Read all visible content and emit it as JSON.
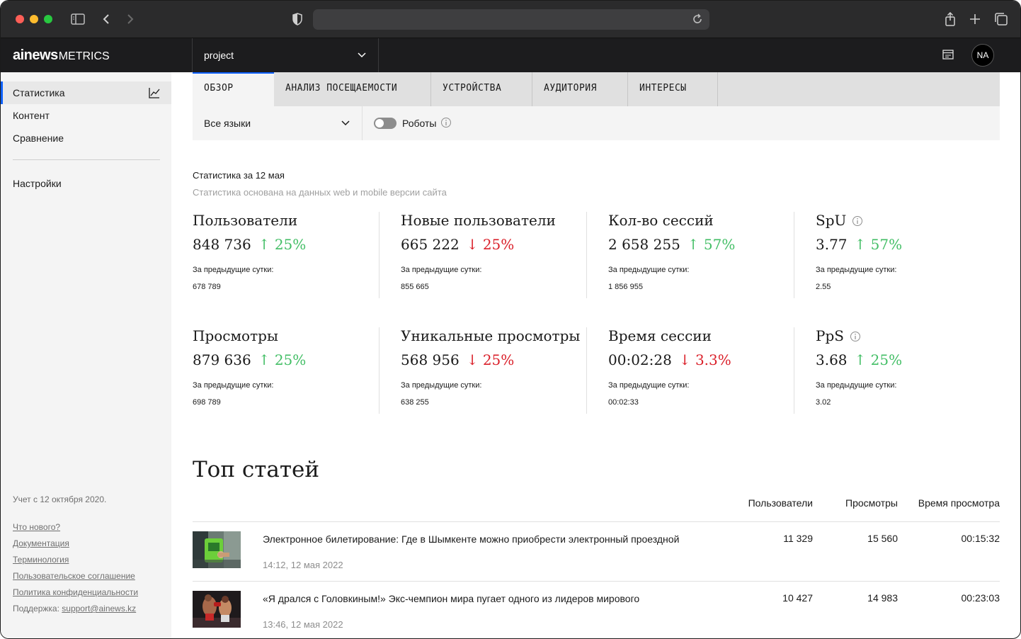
{
  "header": {
    "logo_main": "ainews",
    "logo_sub": "METRICS",
    "project": "project",
    "avatar": "NA"
  },
  "sidebar": {
    "items": [
      {
        "label": "Статистика",
        "icon": "chart-line-icon"
      },
      {
        "label": "Контент"
      },
      {
        "label": "Сравнение"
      },
      {
        "label": "Настройки"
      }
    ],
    "since": "Учет с 12 октября 2020.",
    "links": [
      "Что нового?",
      "Документация",
      "Терминология",
      "Пользовательское соглашение",
      "Политика конфиденциальности"
    ],
    "support_label": "Поддержка:",
    "support_email": "support@ainews.kz"
  },
  "tabs": [
    "ОБЗОР",
    "АНАЛИЗ ПОСЕЩАЕМОСТИ",
    "УСТРОЙСТВА",
    "АУДИТОРИЯ",
    "ИНТЕРЕСЫ"
  ],
  "filters": {
    "language": "Все языки",
    "robots_label": "Роботы",
    "robots_on": false
  },
  "stats": {
    "title": "Статистика за 12 мая",
    "subtitle": "Статистика основана на данных web и mobile версии сайта",
    "prev_label": "За предыдущие сутки:",
    "cards": [
      {
        "name": "Пользователи",
        "value": "848 736",
        "delta": "↑ 25%",
        "direction": "up",
        "prev": "678 789"
      },
      {
        "name": "Новые пользователи",
        "value": "665 222",
        "delta": "↓ 25%",
        "direction": "down",
        "prev": "855 665"
      },
      {
        "name": "Кол-во сессий",
        "value": "2 658 255",
        "delta": "↑ 57%",
        "direction": "up",
        "prev": "1 856 955"
      },
      {
        "name": "SpU",
        "value": "3.77",
        "delta": "↑ 57%",
        "direction": "up",
        "prev": "2.55",
        "info": true
      },
      {
        "name": "Просмотры",
        "value": "879 636",
        "delta": "↑ 25%",
        "direction": "up",
        "prev": "698 789"
      },
      {
        "name": "Уникальные просмотры",
        "value": "568 956",
        "delta": "↓ 25%",
        "direction": "down",
        "prev": "638 255"
      },
      {
        "name": "Время сессии",
        "value": "00:02:28",
        "delta": "↓ 3.3%",
        "direction": "down",
        "prev": "00:02:33"
      },
      {
        "name": "PpS",
        "value": "3.68",
        "delta": "↑ 25%",
        "direction": "up",
        "prev": "3.02",
        "info": true
      }
    ]
  },
  "top": {
    "title": "Топ статей",
    "columns": [
      "Пользователи",
      "Просмотры",
      "Время просмотра"
    ],
    "articles": [
      {
        "title": "Электронное билетирование: Где в Шымкенте можно приобрести электронный проездной",
        "date": "14:12, 12 мая 2022",
        "users": "11 329",
        "views": "15 560",
        "time": "00:15:32"
      },
      {
        "title": "«Я дрался с Головкиным!» Экс-чемпион мира пугает одного из лидеров мирового",
        "date": "13:46, 12 мая 2022",
        "users": "10 427",
        "views": "14 983",
        "time": "00:23:03"
      }
    ]
  },
  "colors": {
    "accent": "#0f62fe",
    "up": "#42be65",
    "down": "#da1e28"
  }
}
